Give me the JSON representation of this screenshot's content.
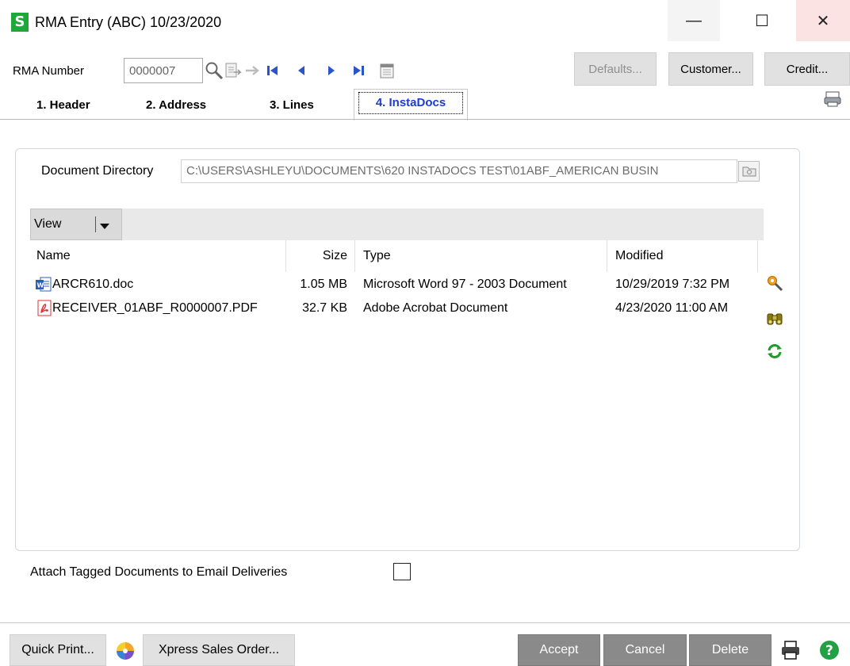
{
  "window": {
    "app_icon_letter": "S",
    "title": "RMA Entry (ABC) 10/23/2020",
    "minimize_glyph": "—",
    "maximize_glyph": "☐",
    "close_glyph": "✕"
  },
  "toolbar": {
    "rma_label": "RMA Number",
    "rma_value": "0000007",
    "defaults_label": "Defaults...",
    "customer_label": "Customer...",
    "credit_label": "Credit..."
  },
  "tabs": [
    {
      "label": "1. Header"
    },
    {
      "label": "2. Address"
    },
    {
      "label": "3. Lines"
    },
    {
      "label": "4. InstaDocs"
    }
  ],
  "instadocs": {
    "directory_label": "Document Directory",
    "directory_value": "C:\\USERS\\ASHLEYU\\DOCUMENTS\\620 INSTADOCS TEST\\01ABF_AMERICAN BUSIN",
    "view_label": "View",
    "columns": {
      "name": "Name",
      "size": "Size",
      "type": "Type",
      "modified": "Modified"
    },
    "files": [
      {
        "name": "ARCR610.doc",
        "size": "1.05 MB",
        "type": "Microsoft Word 97 - 2003 Document",
        "modified": "10/29/2019 7:32 PM",
        "icon": "word-doc-icon"
      },
      {
        "name": "RECEIVER_01ABF_R0000007.PDF",
        "size": "32.7 KB",
        "type": "Adobe Acrobat Document",
        "modified": "4/23/2020 11:00 AM",
        "icon": "pdf-icon"
      }
    ],
    "attach_label": "Attach Tagged Documents to Email Deliveries",
    "attach_checked": false
  },
  "footer": {
    "quick_print_label": "Quick Print...",
    "xpress_label": "Xpress Sales Order...",
    "accept_label": "Accept",
    "cancel_label": "Cancel",
    "delete_label": "Delete"
  },
  "colors": {
    "accent_green": "#1fa83a",
    "tab_active_text": "#1a3cd0",
    "dark_button": "#8a8a8a"
  }
}
